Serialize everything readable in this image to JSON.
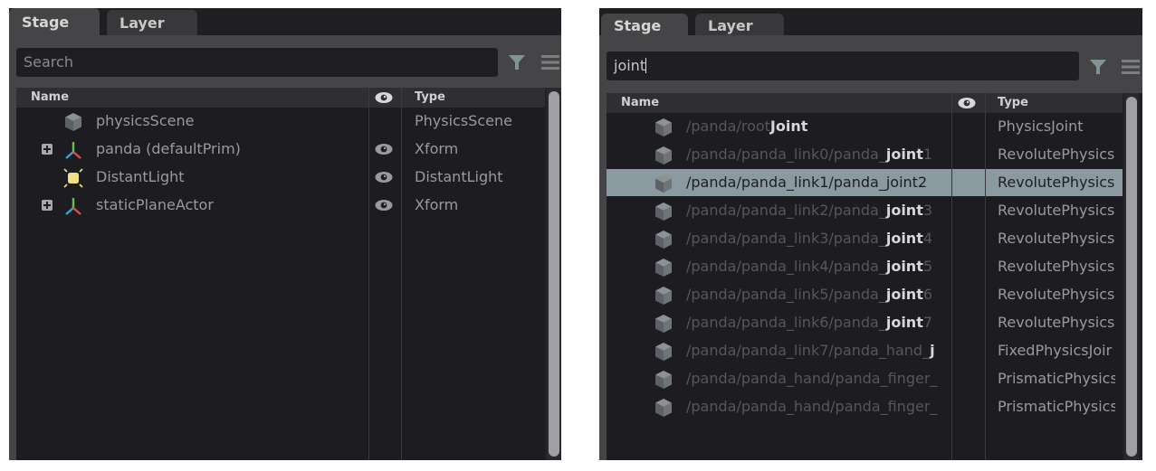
{
  "left_panel": {
    "tabs": [
      {
        "label": "Stage",
        "active": true
      },
      {
        "label": "Layer",
        "active": false
      }
    ],
    "search": {
      "value": "",
      "placeholder": "Search"
    },
    "columns": {
      "name": "Name",
      "visibility": "eye-icon",
      "type": "Type"
    },
    "rows": [
      {
        "name": "physicsScene",
        "type": "PhysicsScene",
        "icon": "cube-icon",
        "expandable": false,
        "visible_toggle": false
      },
      {
        "name": "panda (defaultPrim)",
        "type": "Xform",
        "icon": "xform-axes-icon",
        "expandable": true,
        "visible_toggle": true
      },
      {
        "name": "DistantLight",
        "type": "DistantLight",
        "icon": "light-icon",
        "expandable": false,
        "visible_toggle": true
      },
      {
        "name": "staticPlaneActor",
        "type": "Xform",
        "icon": "xform-axes-icon",
        "expandable": true,
        "visible_toggle": true
      }
    ]
  },
  "right_panel": {
    "tabs": [
      {
        "label": "Stage",
        "active": true
      },
      {
        "label": "Layer",
        "active": false
      }
    ],
    "search": {
      "value": "joint",
      "placeholder": "Search"
    },
    "columns": {
      "name": "Name",
      "visibility": "eye-icon",
      "type": "Type"
    },
    "rows": [
      {
        "prefix": "/panda/root",
        "match": "Joint",
        "suffix": "",
        "type": "PhysicsJoint",
        "selected": false
      },
      {
        "prefix": "/panda/panda_link0/panda_",
        "match": "joint",
        "suffix": "1",
        "type": "RevolutePhysics…",
        "selected": false
      },
      {
        "prefix": "/panda/panda_link1/panda_",
        "match": "joint",
        "suffix": "2",
        "type": "RevolutePhysics…",
        "selected": true
      },
      {
        "prefix": "/panda/panda_link2/panda_",
        "match": "joint",
        "suffix": "3",
        "type": "RevolutePhysics…",
        "selected": false
      },
      {
        "prefix": "/panda/panda_link3/panda_",
        "match": "joint",
        "suffix": "4",
        "type": "RevolutePhysics…",
        "selected": false
      },
      {
        "prefix": "/panda/panda_link4/panda_",
        "match": "joint",
        "suffix": "5",
        "type": "RevolutePhysics…",
        "selected": false
      },
      {
        "prefix": "/panda/panda_link5/panda_",
        "match": "joint",
        "suffix": "6",
        "type": "RevolutePhysics…",
        "selected": false
      },
      {
        "prefix": "/panda/panda_link6/panda_",
        "match": "joint",
        "suffix": "7",
        "type": "RevolutePhysics…",
        "selected": false
      },
      {
        "prefix": "/panda/panda_link7/panda_hand_",
        "match": "j",
        "suffix": "",
        "type": "FixedPhysicsJoir",
        "selected": false
      },
      {
        "prefix": "/panda/panda_hand/panda_finger_",
        "match": "",
        "suffix": "",
        "type": "PrismaticPhysics",
        "selected": false
      },
      {
        "prefix": "/panda/panda_hand/panda_finger_",
        "match": "",
        "suffix": "",
        "type": "PrismaticPhysics",
        "selected": false
      }
    ]
  },
  "colors": {
    "panel_bg": "#222226",
    "toolbar_bg": "#454548",
    "selection": "#8a9aa0",
    "filter_icon": "#7f9494"
  }
}
